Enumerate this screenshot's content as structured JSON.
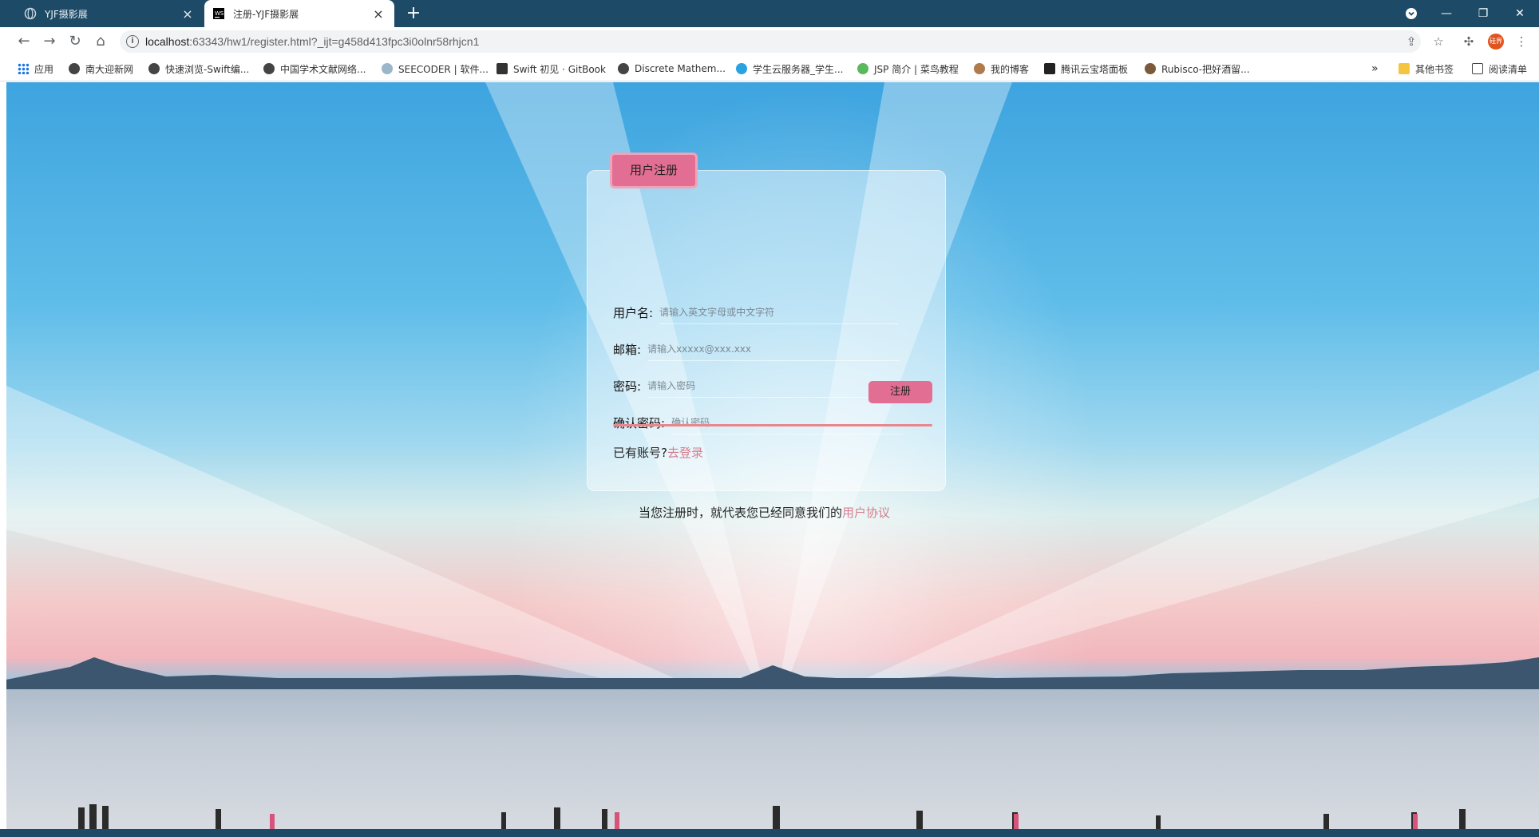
{
  "browser": {
    "tabs": [
      {
        "title": "YJF摄影展",
        "active": false
      },
      {
        "title": "注册-YJF摄影展",
        "active": true
      }
    ],
    "new_tab": "+",
    "url_host": "localhost",
    "url_rest": ":63343/hw1/register.html?_ijt=g458d413fpc3i0olnr58rhjcn1",
    "profile_label": "硅界",
    "bookmarks": [
      "应用",
      "南大迎新网",
      "快速浏览-Swift编...",
      "中国学术文献网络...",
      "SEECODER | 软件...",
      "Swift 初见 · GitBook",
      "Discrete Mathem...",
      "学生云服务器_学生...",
      "JSP 简介 | 菜鸟教程",
      "我的博客",
      "腾讯云宝塔面板",
      "Rubisco-把好酒留..."
    ],
    "bookmarks_more": "»",
    "other_bookmarks": "其他书签",
    "reading_list": "阅读清单"
  },
  "form": {
    "title": "用户注册",
    "username_label": "用户名:",
    "username_placeholder": "请输入英文字母或中文字符",
    "email_label": "邮箱:",
    "email_placeholder": "请输入xxxxx@xxx.xxx",
    "password_label": "密码:",
    "password_placeholder": "请输入密码",
    "confirm_label": "确认密码:",
    "confirm_placeholder": "确认密码",
    "submit_label": "注册",
    "has_account_text": "已有账号?",
    "login_link": "去登录"
  },
  "agreement": {
    "text": "当您注册时，就代表您已经同意我们的",
    "link": "用户协议"
  },
  "colors": {
    "accent": "#e26f93",
    "link": "#d47e8e",
    "divider": "#e8878c",
    "tabbar": "#1d4a66"
  }
}
